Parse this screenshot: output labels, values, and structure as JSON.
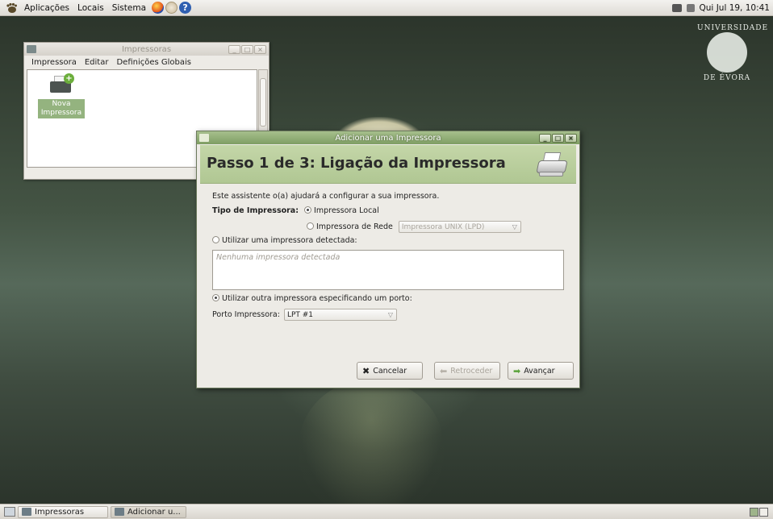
{
  "top_panel": {
    "menus": [
      "Aplicações",
      "Locais",
      "Sistema"
    ],
    "icons": [
      "gnome-foot-icon",
      "firefox-icon",
      "mail-icon",
      "help-icon"
    ],
    "clock": "Qui Jul 19, 10:41"
  },
  "desktop": {
    "logo_top": "UNIVERSIDADE",
    "logo_bottom": "DE ÉVORA"
  },
  "printers_window": {
    "title": "Impressoras",
    "menu": [
      "Impressora",
      "Editar",
      "Definições Globais"
    ],
    "icon_label": "Nova Impressora"
  },
  "dialog": {
    "title": "Adicionar uma Impressora",
    "header": "Passo 1 de 3: Ligação da Impressora",
    "intro": "Este assistente o(a) ajudará a configurar a sua impressora.",
    "printer_type_label": "Tipo de Impressora:",
    "local_printer": "Impressora Local",
    "network_printer": "Impressora de Rede",
    "network_combo_value": "Impressora UNIX (LPD)",
    "use_detected": "Utilizar uma impressora detectada:",
    "no_detected": "Nenhuma impressora detectada",
    "use_other": "Utilizar outra impressora especificando um porto:",
    "port_label": "Porto Impressora:",
    "port_value": "LPT #1",
    "buttons": {
      "cancel": "Cancelar",
      "back": "Retroceder",
      "forward": "Avançar"
    }
  },
  "taskbar": {
    "tasks": [
      "Impressoras",
      "Adicionar u..."
    ]
  }
}
